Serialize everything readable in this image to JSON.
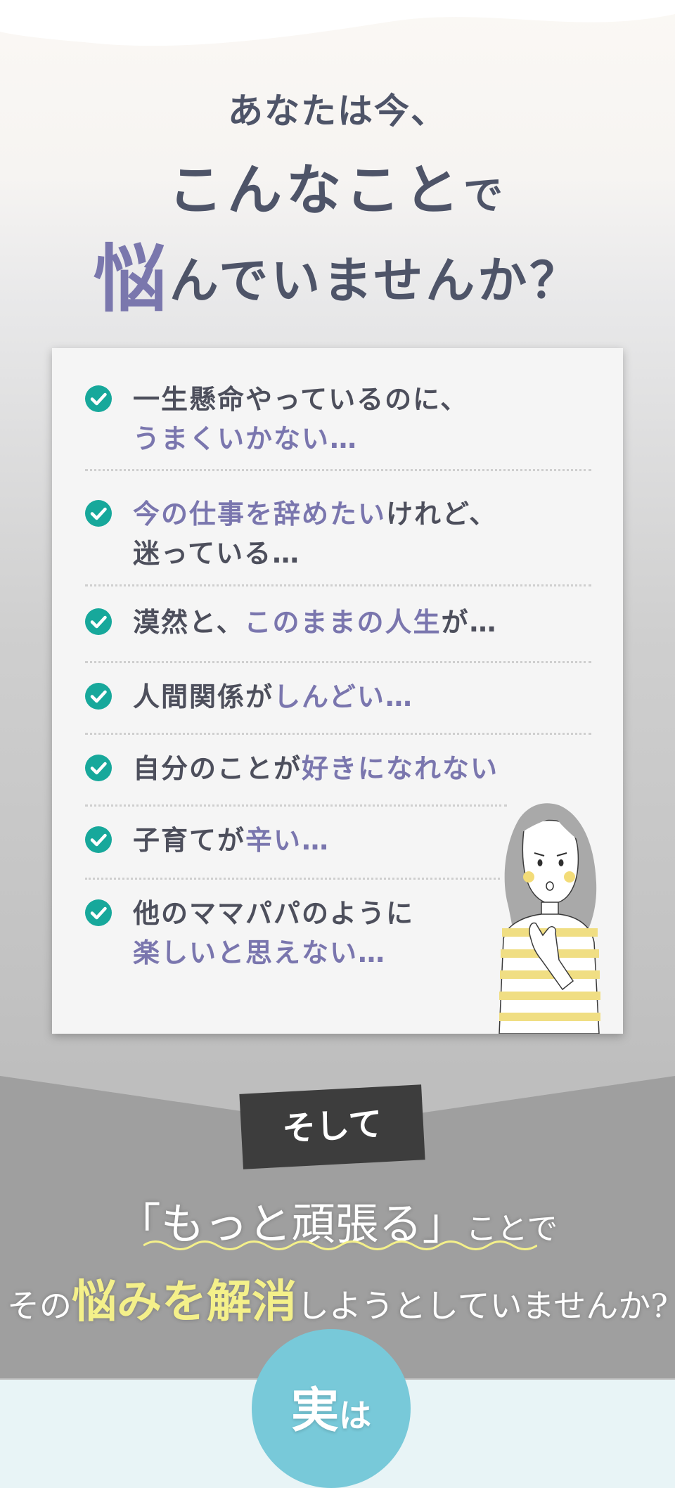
{
  "heading": {
    "line1": "あなたは今、",
    "line2_main": "こんなこと",
    "line2_small": "で",
    "line3_accent": "悩",
    "line3_rest": "んでいませんか？"
  },
  "checklist": [
    {
      "line1": [
        {
          "text": "一生懸命やっているのに、",
          "hl": false
        }
      ],
      "line2": [
        {
          "text": "うまくいかない…",
          "hl": true
        }
      ]
    },
    {
      "line1": [
        {
          "text": "今の仕事を辞めたい",
          "hl": true
        },
        {
          "text": "けれど、",
          "hl": false
        }
      ],
      "line2": [
        {
          "text": "迷っている…",
          "hl": false
        }
      ]
    },
    {
      "line1": [
        {
          "text": "漠然と、",
          "hl": false
        },
        {
          "text": "このままの人生",
          "hl": true
        },
        {
          "text": "が…",
          "hl": false
        }
      ]
    },
    {
      "line1": [
        {
          "text": "人間関係が",
          "hl": false
        },
        {
          "text": "しんどい…",
          "hl": true
        }
      ]
    },
    {
      "line1": [
        {
          "text": "自分のことが",
          "hl": false
        },
        {
          "text": "好きになれない",
          "hl": true
        }
      ]
    },
    {
      "line1": [
        {
          "text": "子育てが",
          "hl": false
        },
        {
          "text": "辛い…",
          "hl": true
        }
      ]
    },
    {
      "line1": [
        {
          "text": "他のママパパのように",
          "hl": false
        }
      ],
      "line2": [
        {
          "text": "楽しいと思えない…",
          "hl": true
        }
      ]
    }
  ],
  "soshite": "そして",
  "message": {
    "open_bracket": "「",
    "effort": "もっと頑張る",
    "close_bracket": "」",
    "koto_de": "ことで",
    "sono": "その",
    "nayami": "悩みを解消",
    "rest": "しようとしていませんか?"
  },
  "jitsu": {
    "big": "実",
    "small": "は"
  },
  "colors": {
    "heading": "#4e5468",
    "accent": "#7a77ad",
    "check": "#17a89b",
    "highlight_yellow": "#f4f08a",
    "circle": "#78c9d9"
  }
}
